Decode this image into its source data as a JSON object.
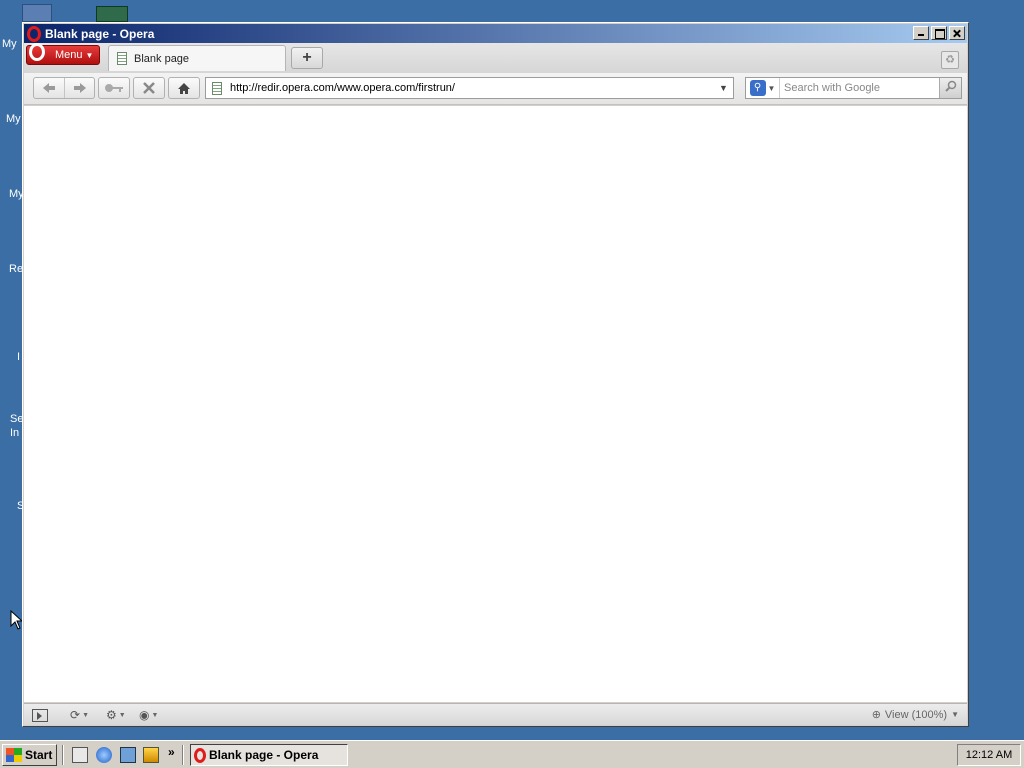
{
  "desktop": {
    "icon_labels": [
      "My",
      "My",
      "My",
      "Re",
      "I",
      "Se",
      "In",
      "S"
    ]
  },
  "window": {
    "title": "Blank page - Opera"
  },
  "tabstrip": {
    "menu_label": "Menu",
    "tabs": [
      {
        "label": "Blank page"
      }
    ],
    "new_tab_symbol": "+"
  },
  "toolbar": {
    "address_value": "http://redir.opera.com/www.opera.com/firstrun/",
    "search_placeholder": "Search with Google"
  },
  "statusbar": {
    "zoom_label": "View (100%)"
  },
  "taskbar": {
    "start_label": "Start",
    "task_label": "Blank page - Opera",
    "clock": "12:12 AM",
    "quicklaunch_more": "»"
  },
  "colors": {
    "desktop": "#3a6ea5",
    "titlebar_start": "#0a246a",
    "titlebar_end": "#a6caf0",
    "opera_red": "#e01b1b"
  }
}
